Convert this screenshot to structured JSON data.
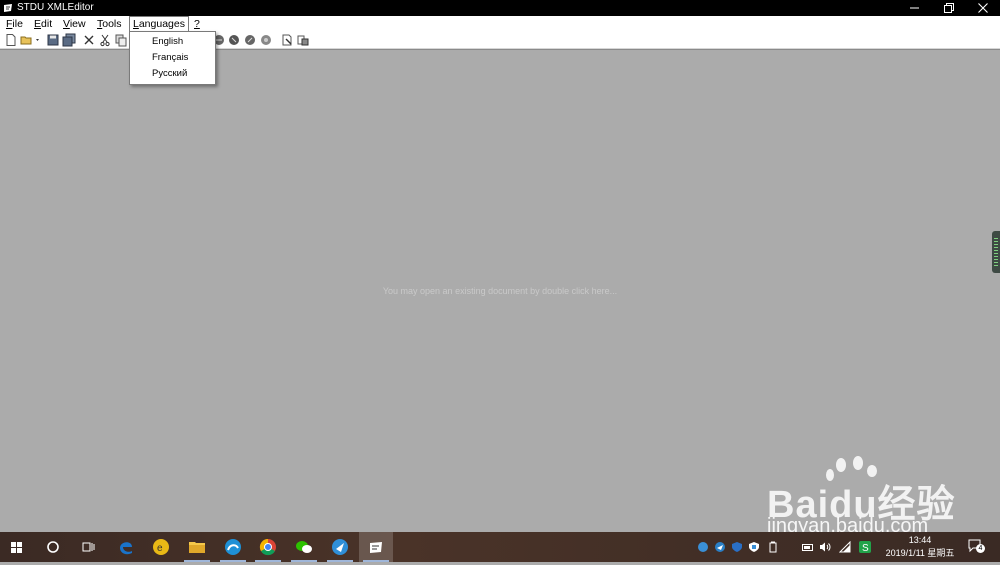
{
  "window": {
    "title": "STDU XMLEditor"
  },
  "menubar": {
    "items": [
      {
        "label": "File",
        "key": "F",
        "rest": "ile"
      },
      {
        "label": "Edit",
        "key": "E",
        "rest": "dit"
      },
      {
        "label": "View",
        "key": "V",
        "rest": "iew"
      },
      {
        "label": "Tools",
        "key": "T",
        "rest": "ools"
      },
      {
        "label": "Languages",
        "key": "L",
        "rest": "anguages"
      },
      {
        "label": "?",
        "key": "?",
        "rest": ""
      }
    ]
  },
  "dropdown": {
    "items": [
      "English",
      "Français",
      "Русский"
    ]
  },
  "main": {
    "hint": "You may open an existing document by double click here..."
  },
  "toolbar": {
    "buttons": [
      "new-icon",
      "open-icon",
      "save-icon",
      "save-all-icon",
      "delete-icon",
      "cut-icon",
      "copy-icon",
      "toolbar-icon",
      "toolbar-icon",
      "toolbar-icon",
      "toolbar-icon",
      "toolbar-icon",
      "toolbar-icon"
    ]
  },
  "taskbar": {
    "apps": [
      "start-icon",
      "search-icon",
      "task-view-icon",
      "edge-icon",
      "app-icon",
      "file-explorer-icon",
      "app-icon",
      "chrome-icon",
      "wechat-icon",
      "app-icon",
      "stdu-xmleditor-icon"
    ],
    "clock": {
      "time": "13:44",
      "date": "2019/1/11 星期五"
    },
    "notifications": "4"
  },
  "watermark": {
    "brand": "Baidu经验",
    "url": "jingyan.baidu.com"
  },
  "colors": {
    "titlebar": "#000000",
    "workspace": "#ababab",
    "hint_text": "#c9c9c9",
    "taskbar": "#3b2a24",
    "edge_blue": "#1a73c9",
    "chrome_red": "#db4437"
  }
}
